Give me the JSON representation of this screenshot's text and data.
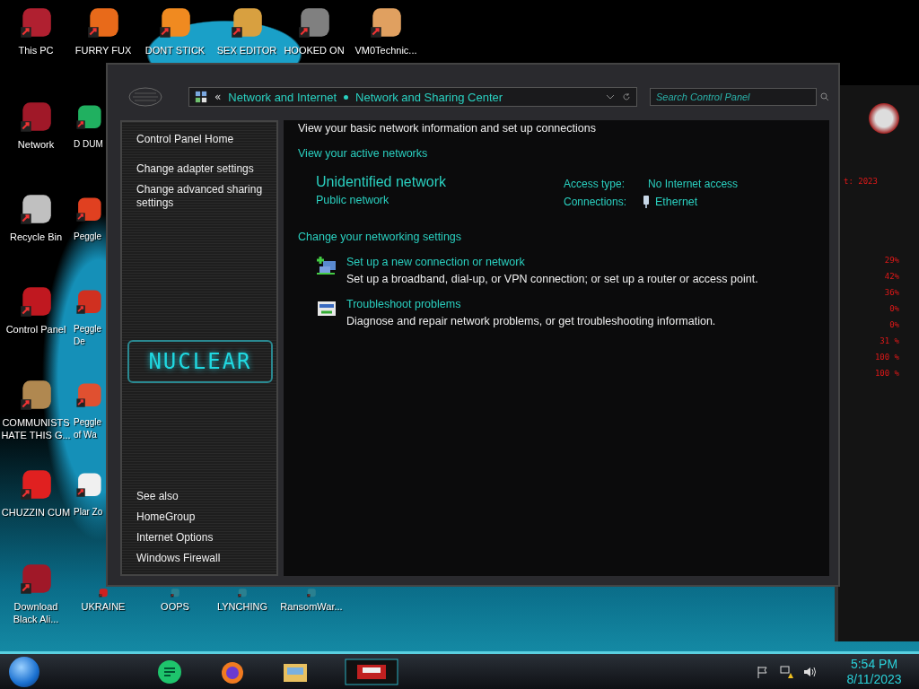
{
  "desktop": {
    "icons": [
      {
        "label": "This PC"
      },
      {
        "label": "FURRY FUX"
      },
      {
        "label": "DONT STICK"
      },
      {
        "label": "SEX EDITOR"
      },
      {
        "label": "HOOKED ON"
      },
      {
        "label": "VM0Technic..."
      },
      {
        "label": "Network"
      },
      {
        "label": "D DUM"
      },
      {
        "label": "Recycle Bin"
      },
      {
        "label": "Peggle"
      },
      {
        "label": "Control Panel"
      },
      {
        "label": "Peggle De"
      },
      {
        "label": "COMMUNISTS HATE THIS G..."
      },
      {
        "label": "Peggle of Wa"
      },
      {
        "label": "CHUZZIN CUM"
      },
      {
        "label": "Plar Zo"
      },
      {
        "label": "Download Black Ali..."
      },
      {
        "label": "UKRAINE"
      },
      {
        "label": "OOPS"
      },
      {
        "label": "LYNCHING"
      },
      {
        "label": "RansomWar..."
      }
    ]
  },
  "gadget": {
    "readings": [
      "t: 2023",
      "29%",
      "42%",
      "36%",
      "0%",
      "0%",
      "31 %",
      "100 %",
      "100 %"
    ]
  },
  "window": {
    "address_bar": {
      "overflow": "«",
      "crumbs": [
        "Network and Internet",
        "Network and Sharing Center"
      ]
    },
    "search": {
      "placeholder": "Search Control Panel"
    },
    "sidebar": {
      "links": [
        "Control Panel Home",
        "Change adapter settings",
        "Change advanced sharing settings"
      ],
      "logo": "NUCLEAR",
      "see_also_title": "See also",
      "see_also": [
        "HomeGroup",
        "Internet Options",
        "Windows Firewall"
      ]
    },
    "content": {
      "heading": "View your basic network information and set up connections",
      "active_title": "View your active networks",
      "network": {
        "name": "Unidentified network",
        "type": "Public network",
        "access_label": "Access type:",
        "access_value": "No Internet access",
        "connections_label": "Connections:",
        "connections_value": "Ethernet"
      },
      "settings_title": "Change your networking settings",
      "tasks": [
        {
          "title": "Set up a new connection or network",
          "description": "Set up a broadband, dial-up, or VPN connection; or set up a router or access point."
        },
        {
          "title": "Troubleshoot problems",
          "description": "Diagnose and repair network problems, or get troubleshooting information."
        }
      ]
    }
  },
  "taskbar": {
    "clock": {
      "time": "5:54 PM",
      "date": "8/11/2023"
    }
  }
}
